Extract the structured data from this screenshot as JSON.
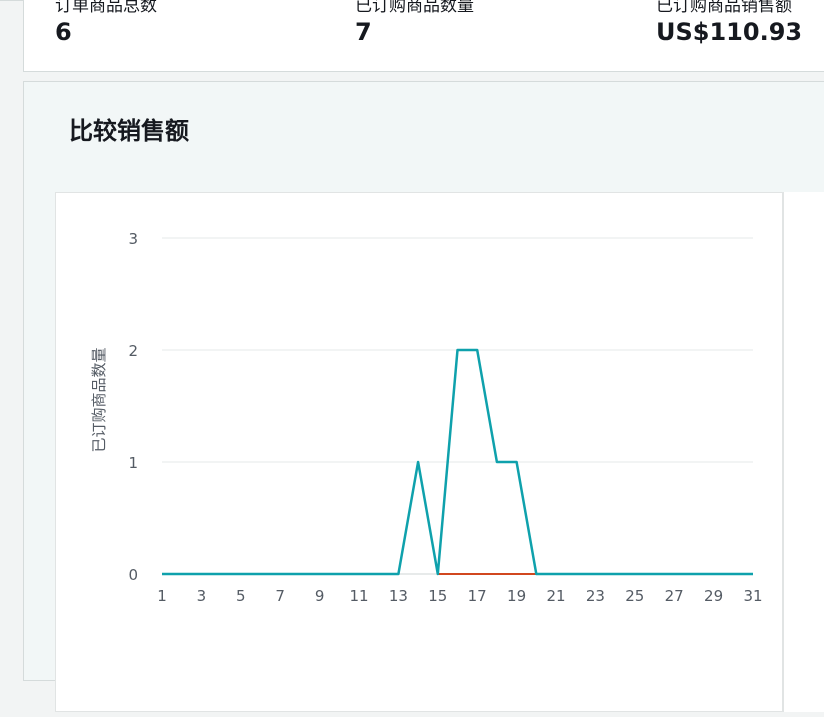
{
  "metrics": [
    {
      "label": "订单商品总数",
      "value": "6"
    },
    {
      "label": "已订购商品数量",
      "value": "7"
    },
    {
      "label": "已订购商品销售额",
      "value": "US$110.93"
    }
  ],
  "section": {
    "title": "比较销售额"
  },
  "chart_data": {
    "type": "line",
    "title": "",
    "xlabel": "",
    "ylabel": "已订购商品数量",
    "x": [
      1,
      2,
      3,
      4,
      5,
      6,
      7,
      8,
      9,
      10,
      11,
      12,
      13,
      14,
      15,
      16,
      17,
      18,
      19,
      20,
      21,
      22,
      23,
      24,
      25,
      26,
      27,
      28,
      29,
      30,
      31
    ],
    "xticks": [
      1,
      3,
      5,
      7,
      9,
      11,
      13,
      15,
      17,
      19,
      21,
      23,
      25,
      27,
      29,
      31
    ],
    "yticks": [
      0,
      1,
      2,
      3
    ],
    "ylim": [
      0,
      3
    ],
    "xlim": [
      1,
      31
    ],
    "grid": true,
    "series": [
      {
        "values": [
          0,
          0,
          0,
          0,
          0,
          0,
          0,
          0,
          0,
          0,
          0,
          0,
          0,
          1,
          0,
          2,
          2,
          1,
          1,
          0,
          0,
          0,
          0,
          0,
          0,
          0,
          0,
          0,
          0,
          0,
          0
        ],
        "color": "#0fa1ac"
      },
      {
        "values": [
          null,
          null,
          null,
          null,
          null,
          null,
          null,
          null,
          null,
          null,
          null,
          null,
          null,
          null,
          0,
          0,
          0,
          0,
          0,
          0,
          0,
          0,
          0,
          0,
          0,
          0,
          0,
          0,
          0,
          0,
          0
        ],
        "color": "#d1471f"
      }
    ]
  }
}
